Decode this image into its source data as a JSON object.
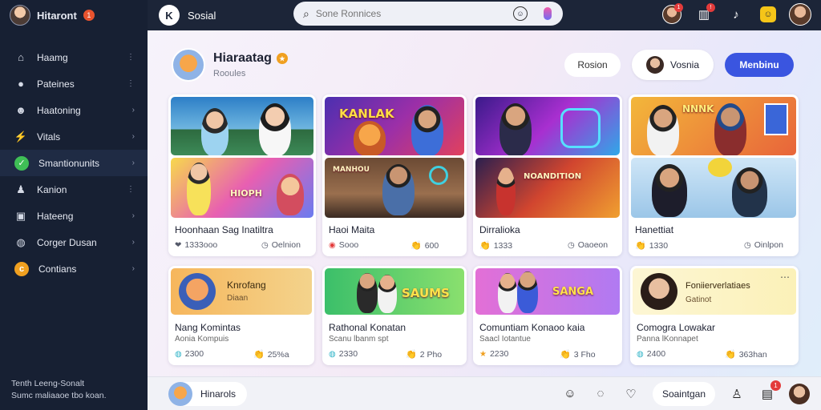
{
  "sidebar": {
    "title": "Hitaront",
    "badge": "1",
    "items": [
      {
        "label": "Haamg",
        "icon": "home-icon",
        "chevron": "⋮"
      },
      {
        "label": "Pateines",
        "icon": "user-icon",
        "chevron": "⋮"
      },
      {
        "label": "Haatoning",
        "icon": "group-icon",
        "chevron": "›"
      },
      {
        "label": "Vitals",
        "icon": "bolt-icon",
        "chevron": "›"
      },
      {
        "label": "Smantionunits",
        "icon": "check-circle-icon",
        "chevron": "›",
        "active": true
      },
      {
        "label": "Kanion",
        "icon": "person-icon",
        "chevron": "⋮"
      },
      {
        "label": "Hateeng",
        "icon": "image-icon",
        "chevron": "›"
      },
      {
        "label": "Corger Dusan",
        "icon": "globe-icon",
        "chevron": "›"
      },
      {
        "label": "Contians",
        "icon": "coin-icon",
        "chevron": "›"
      }
    ],
    "footer_line1": "Tenth Leeng-Sonalt",
    "footer_line2": "Sumc maliaaoe tbo koan."
  },
  "topbar": {
    "app_name": "Sosial",
    "search_placeholder": "Sone Ronnices"
  },
  "profile": {
    "title": "Hiaraatag",
    "subtitle": "Rooules"
  },
  "actions": {
    "light_button": "Rosion",
    "user_button": "Vosnia",
    "primary_button": "Menbinu"
  },
  "cards_row1": [
    {
      "title": "Hoonhaan Sag Inatiltra",
      "meta": "1333ooo",
      "meta2": "Oelnion",
      "thumb_top_label": "",
      "thumb_bottom_label": "HIOPH"
    },
    {
      "title": "Haoi Maita",
      "meta": "Sooo",
      "meta2": "600",
      "thumb_top_label": "KANLAK",
      "thumb_bottom_label": "MANHOU"
    },
    {
      "title": "Dirralioka",
      "meta": "1333",
      "meta2": "Oaoeon",
      "thumb_top_label": "",
      "thumb_bottom_label": "NOANDITION"
    },
    {
      "title": "Hanettiat",
      "meta": "1330",
      "meta2": "Oinlpon",
      "thumb_top_label": "NNNK",
      "thumb_bottom_label": ""
    }
  ],
  "cards_row2": [
    {
      "header_title": "Knrofang",
      "header_sub": "Diaan",
      "title": "Nang Komintas",
      "meta": "Aonia Kompuis",
      "count": "2300",
      "count2": "25%a"
    },
    {
      "header_title": "",
      "header_sub": "",
      "banner": "SAUMS",
      "title": "Rathonal Konatan",
      "meta": "Scanu lbanm spt",
      "count": "2330",
      "count2": "2 Pho"
    },
    {
      "header_title": "",
      "header_sub": "",
      "banner": "SANGA",
      "title": "Comuntiam Konaoo kaia",
      "meta": "Saacl Iotantue",
      "count": "2230",
      "count2": "3 Fho"
    },
    {
      "header_title": "Foniierverlatiaes",
      "header_sub": "Gatinot",
      "title": "Comogra Lowakar",
      "meta": "Panna lKonnapet",
      "count": "2400",
      "count2": "363han"
    }
  ],
  "bottombar": {
    "user_label": "Hinarols",
    "button_label": "Soaintgan",
    "notif_badge": "1"
  }
}
